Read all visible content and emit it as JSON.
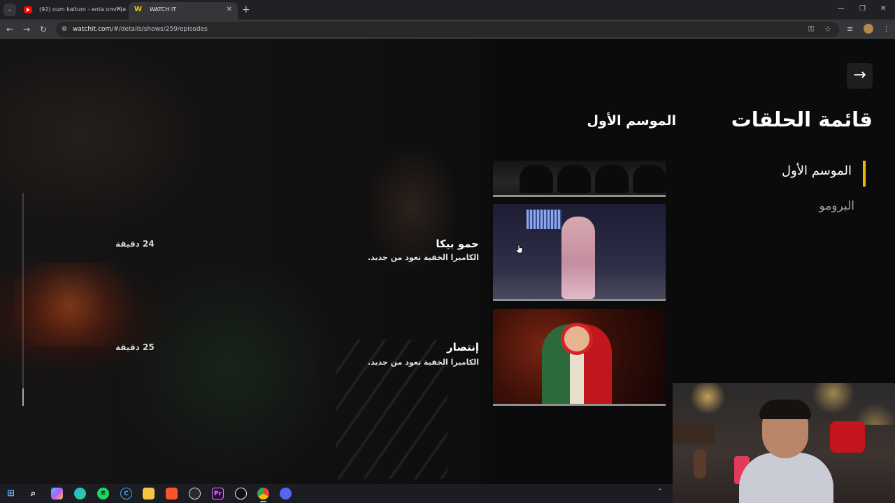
{
  "browser": {
    "tabs": [
      {
        "title": "(92) oum kaltum - enta omri (e",
        "favicon": "youtube-icon",
        "active": false
      },
      {
        "title": "WATCH IT",
        "favicon": "watchit-icon",
        "active": true
      }
    ],
    "url_host": "watchit.com",
    "url_path": "/#/details/shows/259/episodes"
  },
  "page": {
    "title": "قائمة الحلقات",
    "season_heading": "الموسم الأول",
    "seasons": [
      {
        "label": "الموسم الأول",
        "active": true
      },
      {
        "label": "البرومو",
        "active": false
      }
    ],
    "episodes": [
      {
        "title": "حمو بيكا",
        "description": "الكاميرا الخفية تعود من جديد.",
        "duration": "24 دقيقة"
      },
      {
        "title": "إنتصار",
        "description": "الكاميرا الخفية تعود من جديد.",
        "duration": "25 دقيقة"
      }
    ],
    "accent_color": "#f2b705"
  },
  "taskbar": {
    "icons": [
      "windows-start-icon",
      "search-icon",
      "copilot-icon",
      "edge-icon",
      "spotify-icon",
      "c-app-icon",
      "file-explorer-icon",
      "brave-icon",
      "obs-icon",
      "premiere-pro-icon",
      "capcut-icon",
      "chrome-icon",
      "discord-icon"
    ]
  }
}
